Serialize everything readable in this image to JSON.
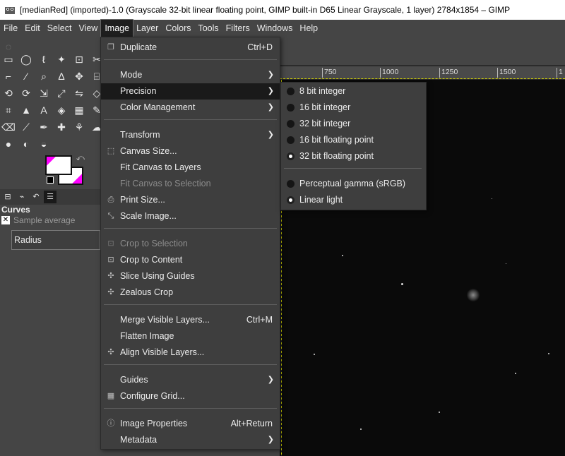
{
  "window": {
    "title": "[medianRed] (imported)-1.0 (Grayscale 32-bit linear floating point, GIMP built-in D65 Linear Grayscale, 1 layer) 2784x1854 – GIMP"
  },
  "menubar": {
    "items": [
      "File",
      "Edit",
      "Select",
      "View",
      "Image",
      "Layer",
      "Colors",
      "Tools",
      "Filters",
      "Windows",
      "Help"
    ]
  },
  "toolbox": {
    "dock_title": "Curves",
    "sample_average_label": "Sample average",
    "radius_label": "Radius",
    "fg_color": "#ff00ff",
    "bg_color": "#ffffff"
  },
  "ruler": {
    "ticks": [
      "750",
      "1000",
      "1250",
      "1500",
      "1"
    ]
  },
  "image_menu": {
    "duplicate": {
      "label": "Duplicate",
      "shortcut": "Ctrl+D"
    },
    "mode": "Mode",
    "precision": "Precision",
    "color_management": "Color Management",
    "transform": "Transform",
    "canvas_size": "Canvas Size...",
    "fit_canvas_to_layers": "Fit Canvas to Layers",
    "fit_canvas_to_selection": "Fit Canvas to Selection",
    "print_size": "Print Size...",
    "scale_image": "Scale Image...",
    "crop_to_selection": "Crop to Selection",
    "crop_to_content": "Crop to Content",
    "slice_using_guides": "Slice Using Guides",
    "zealous_crop": "Zealous Crop",
    "merge_visible_layers": {
      "label": "Merge Visible Layers...",
      "shortcut": "Ctrl+M"
    },
    "flatten_image": "Flatten Image",
    "align_visible_layers": "Align Visible Layers...",
    "guides": "Guides",
    "configure_grid": "Configure Grid...",
    "image_properties": {
      "label": "Image Properties",
      "shortcut": "Alt+Return"
    },
    "metadata": "Metadata"
  },
  "precision_menu": {
    "items": [
      {
        "label": "8 bit integer",
        "selected": false
      },
      {
        "label": "16 bit integer",
        "selected": false
      },
      {
        "label": "32 bit integer",
        "selected": false
      },
      {
        "label": "16 bit floating point",
        "selected": false
      },
      {
        "label": "32 bit floating point",
        "selected": true
      }
    ],
    "gamma_items": [
      {
        "label": "Perceptual gamma (sRGB)",
        "selected": false
      },
      {
        "label": "Linear light",
        "selected": true
      }
    ]
  }
}
